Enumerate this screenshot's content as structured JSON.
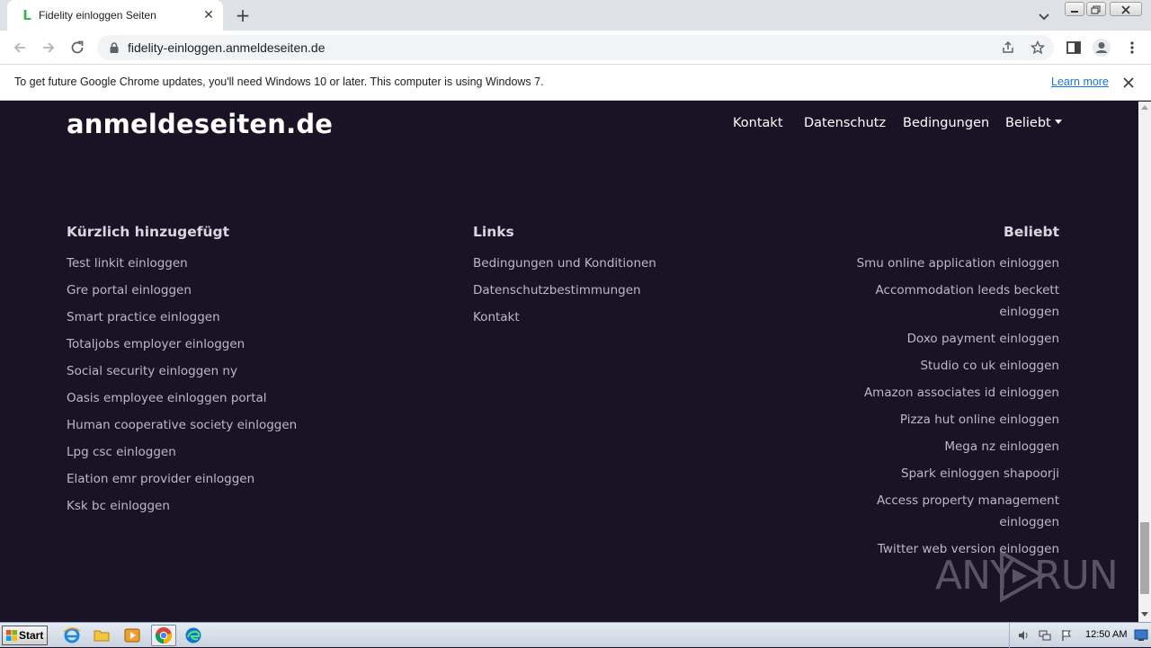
{
  "browser": {
    "tab_title": "Fidelity einloggen Seiten",
    "tab_favicon": "L",
    "url": "fidelity-einloggen.anmeldeseiten.de"
  },
  "infobar": {
    "message": "To get future Google Chrome updates, you'll need Windows 10 or later. This computer is using Windows 7.",
    "learn_more": "Learn more"
  },
  "site": {
    "brand": "anmeldeseiten.de",
    "nav": {
      "kontakt": "Kontakt",
      "datenschutz": "Datenschutz",
      "bedingungen": "Bedingungen",
      "beliebt": "Beliebt"
    }
  },
  "footer": {
    "recent": {
      "heading": "Kürzlich hinzugefügt",
      "items": [
        "Test linkit einloggen",
        "Gre portal einloggen",
        "Smart practice einloggen",
        "Totaljobs employer einloggen",
        "Social security einloggen ny",
        "Oasis employee einloggen portal",
        "Human cooperative society einloggen",
        "Lpg csc einloggen",
        "Elation emr provider einloggen",
        "Ksk bc einloggen"
      ]
    },
    "links": {
      "heading": "Links",
      "items": [
        "Bedingungen und Konditionen",
        "Datenschutzbestimmungen",
        "Kontakt"
      ]
    },
    "popular": {
      "heading": "Beliebt",
      "items": [
        "Smu online application einloggen",
        "Accommodation leeds beckett einloggen",
        "Doxo payment einloggen",
        "Studio co uk einloggen",
        "Amazon associates id einloggen",
        "Pizza hut online einloggen",
        "Mega nz einloggen",
        "Spark einloggen shapoorji",
        "Access property management einloggen",
        "Twitter web version einloggen"
      ]
    }
  },
  "watermark": {
    "left": "ANY",
    "right": "RUN"
  },
  "taskbar": {
    "start_label": "Start",
    "clock": "12:50 AM"
  },
  "colors": {
    "page_background": "#1a1326",
    "link_text": "#bdb8c8",
    "accent_link": "#1a73e8"
  }
}
